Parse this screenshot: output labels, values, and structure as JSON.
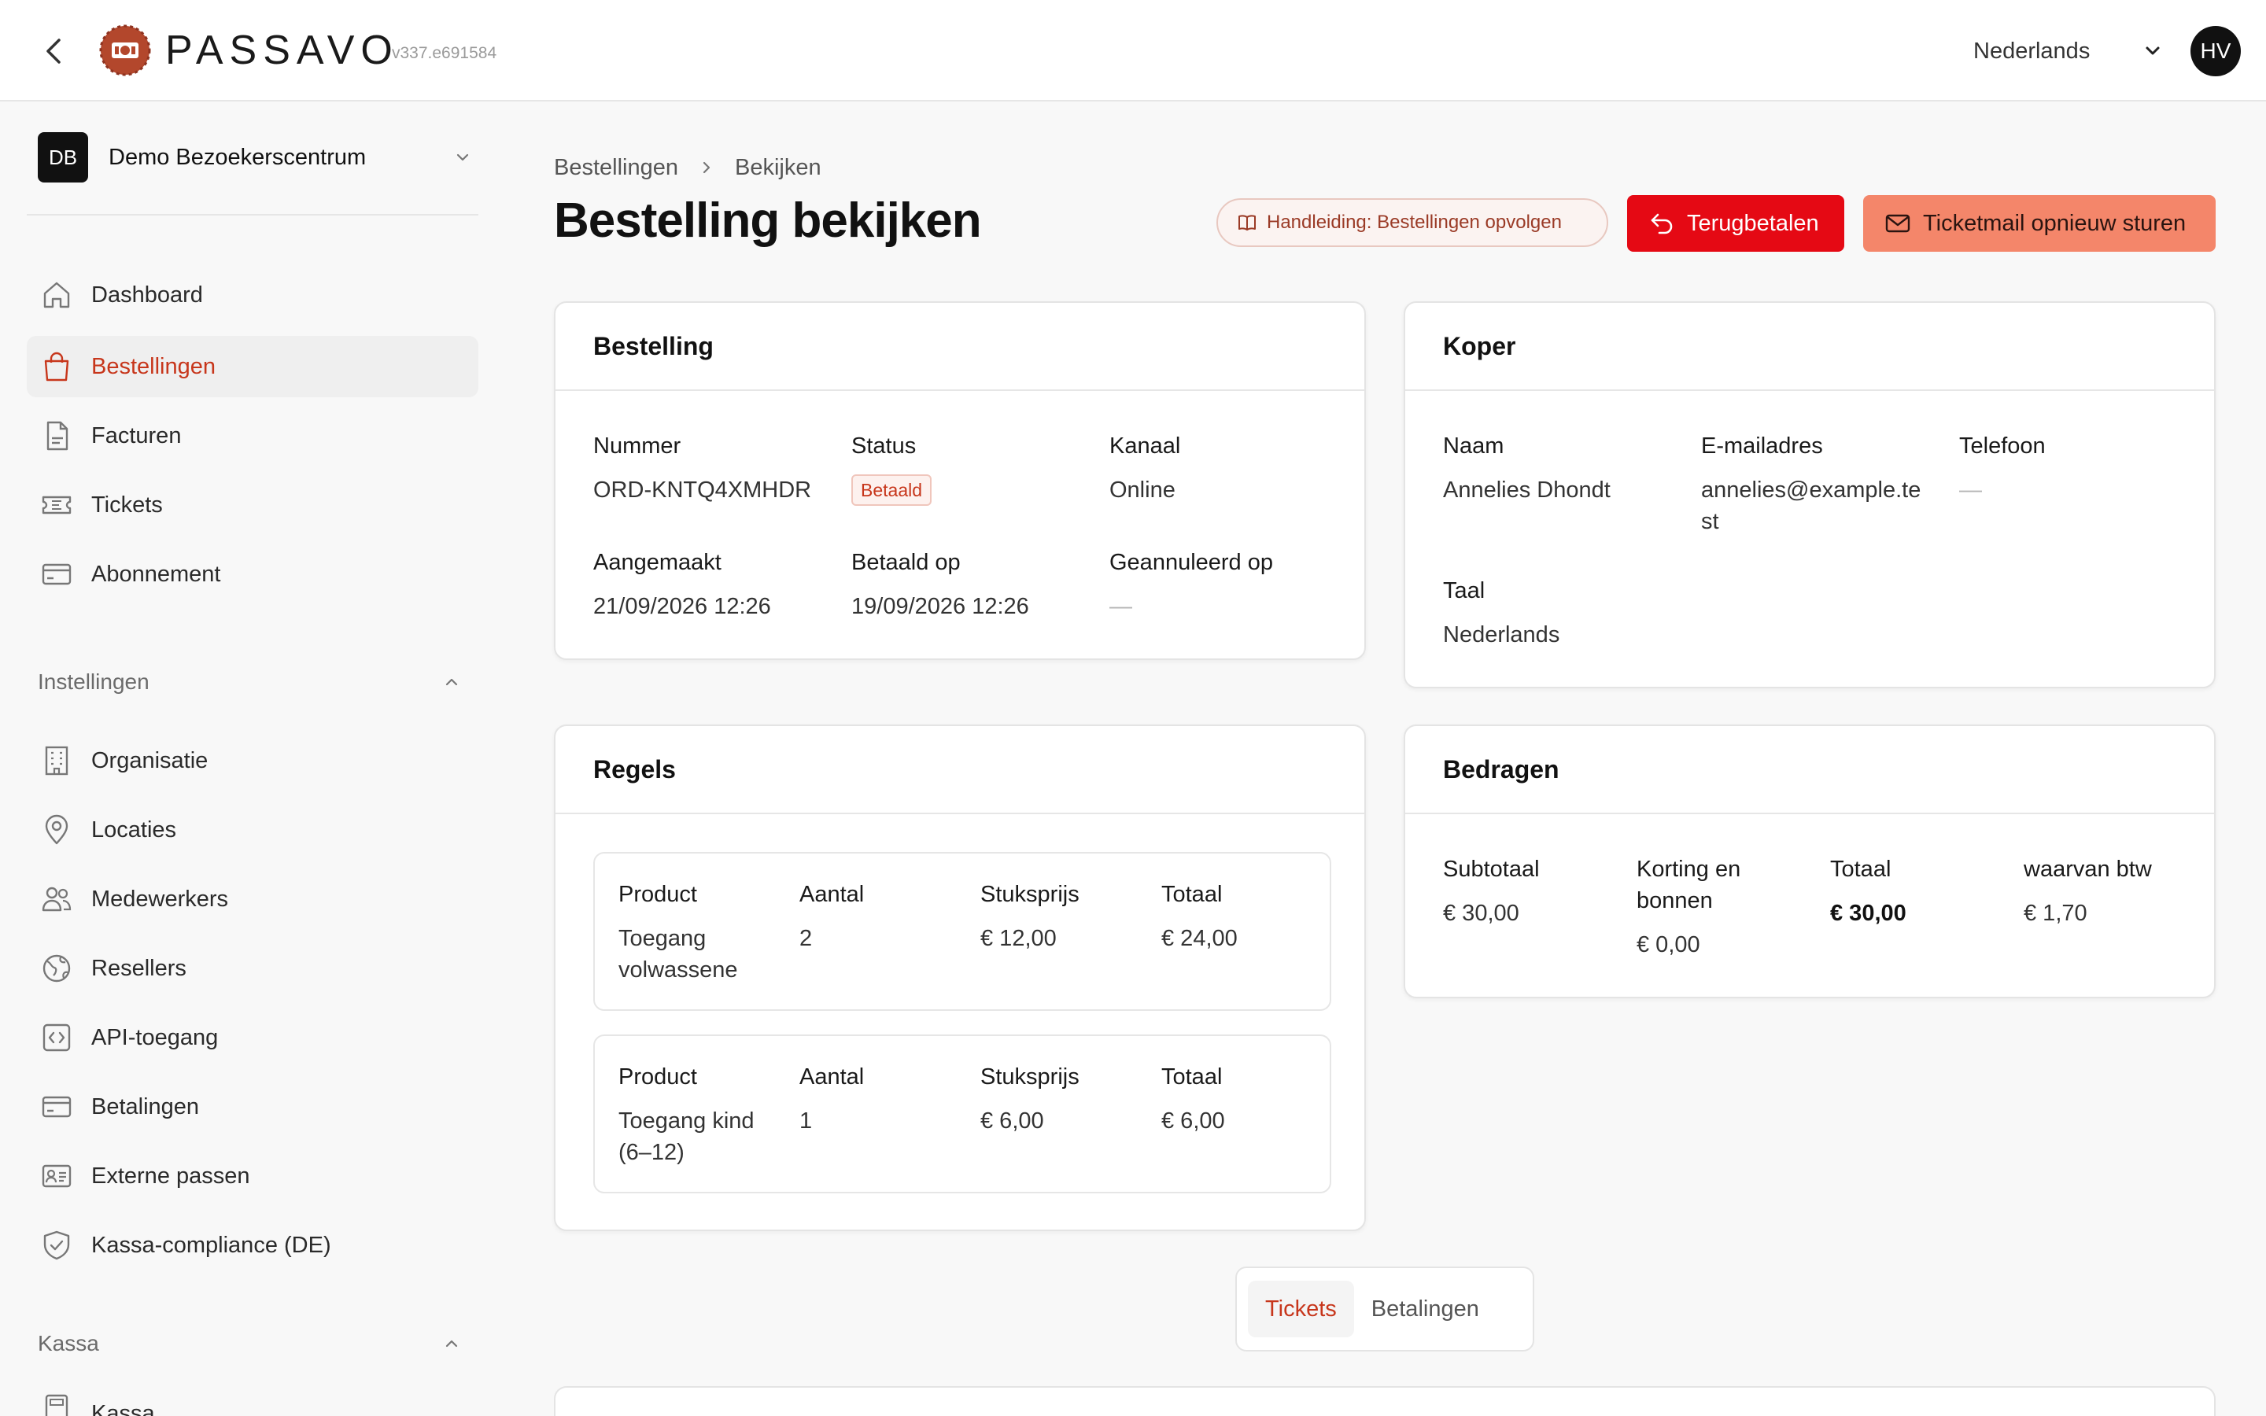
{
  "app": {
    "brand": "PASSAVO",
    "version": "v337.e691584",
    "language": "Nederlands",
    "user_initials": "HV",
    "accent_color": "#c7361b",
    "danger_color": "#e50914",
    "secondary_color": "#f4866a"
  },
  "sidebar": {
    "org": {
      "initials": "DB",
      "name": "Demo Bezoekerscentrum"
    },
    "main_items": [
      {
        "label": "Dashboard",
        "icon": "home-icon",
        "active": false
      },
      {
        "label": "Bestellingen",
        "icon": "shopping-bag-icon",
        "active": true
      },
      {
        "label": "Facturen",
        "icon": "file-icon",
        "active": false
      },
      {
        "label": "Tickets",
        "icon": "ticket-icon",
        "active": false
      },
      {
        "label": "Abonnement",
        "icon": "credit-card-icon",
        "active": false
      }
    ],
    "settings_section": {
      "title": "Instellingen",
      "items": [
        {
          "label": "Organisatie",
          "icon": "building-icon"
        },
        {
          "label": "Locaties",
          "icon": "map-pin-icon"
        },
        {
          "label": "Medewerkers",
          "icon": "users-icon"
        },
        {
          "label": "Resellers",
          "icon": "globe-icon"
        },
        {
          "label": "API-toegang",
          "icon": "code-icon"
        },
        {
          "label": "Betalingen",
          "icon": "credit-card-icon"
        },
        {
          "label": "Externe passen",
          "icon": "id-card-icon"
        },
        {
          "label": "Kassa-compliance (DE)",
          "icon": "shield-check-icon"
        }
      ]
    },
    "kassa_section": {
      "title": "Kassa",
      "items": [
        {
          "label": "Kassa",
          "icon": "calculator-icon"
        }
      ]
    }
  },
  "breadcrumb": {
    "parent": "Bestellingen",
    "current": "Bekijken"
  },
  "page": {
    "title": "Bestelling bekijken",
    "guide_label": "Handleiding: Bestellingen opvolgen",
    "refund_label": "Terugbetalen",
    "resend_label": "Ticketmail opnieuw sturen"
  },
  "order": {
    "title": "Bestelling",
    "number_label": "Nummer",
    "number": "ORD-KNTQ4XMHDR",
    "status_label": "Status",
    "status": "Betaald",
    "channel_label": "Kanaal",
    "channel": "Online",
    "created_label": "Aangemaakt",
    "created": "21/09/2026 12:26",
    "paid_label": "Betaald op",
    "paid": "19/09/2026 12:26",
    "cancelled_label": "Geannuleerd op",
    "cancelled": "—"
  },
  "buyer": {
    "title": "Koper",
    "name_label": "Naam",
    "name": "Annelies Dhondt",
    "email_label": "E-mailadres",
    "email": "annelies@example.test",
    "phone_label": "Telefoon",
    "phone": "—",
    "language_label": "Taal",
    "language": "Nederlands"
  },
  "lines": {
    "title": "Regels",
    "headers": {
      "product": "Product",
      "qty": "Aantal",
      "unit": "Stuksprijs",
      "total": "Totaal"
    },
    "rows": [
      {
        "product": "Toegang volwassene",
        "qty": "2",
        "unit": "€ 12,00",
        "total": "€ 24,00"
      },
      {
        "product": "Toegang kind (6–12)",
        "qty": "1",
        "unit": "€ 6,00",
        "total": "€ 6,00"
      }
    ]
  },
  "amounts": {
    "title": "Bedragen",
    "subtotal_label": "Subtotaal",
    "subtotal": "€ 30,00",
    "discount_label": "Korting en bonnen",
    "discount": "€ 0,00",
    "total_label": "Totaal",
    "total": "€ 30,00",
    "vat_label": "waarvan btw",
    "vat": "€ 1,70"
  },
  "tabs": [
    {
      "label": "Tickets",
      "active": true
    },
    {
      "label": "Betalingen",
      "active": false
    }
  ]
}
